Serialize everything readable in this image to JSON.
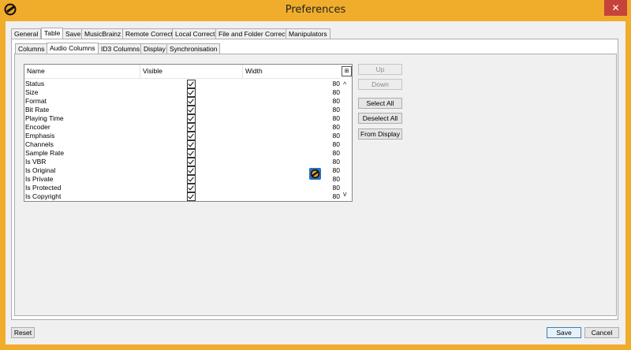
{
  "window": {
    "title": "Preferences",
    "close_label": "✕"
  },
  "top_tabs": [
    "General",
    "Table",
    "Save",
    "MusicBrainz",
    "Remote Correct",
    "Local Correct",
    "File and Folder Correct",
    "Manipulators"
  ],
  "sub_tabs": [
    "Columns",
    "Audio Columns",
    "ID3 Columns",
    "Display",
    "Synchronisation"
  ],
  "table": {
    "headers": [
      "Name",
      "Visible",
      "Width"
    ],
    "rows": [
      {
        "name": "Status",
        "width": "80"
      },
      {
        "name": "Size",
        "width": "80"
      },
      {
        "name": "Format",
        "width": "80"
      },
      {
        "name": "Bit Rate",
        "width": "80"
      },
      {
        "name": "Playing Time",
        "width": "80"
      },
      {
        "name": "Encoder",
        "width": "80"
      },
      {
        "name": "Emphasis",
        "width": "80"
      },
      {
        "name": "Channels",
        "width": "80"
      },
      {
        "name": "Sample Rate",
        "width": "80"
      },
      {
        "name": "Is VBR",
        "width": "80"
      },
      {
        "name": "Is Original",
        "width": "80"
      },
      {
        "name": "Is Private",
        "width": "80"
      },
      {
        "name": "Is Protected",
        "width": "80"
      },
      {
        "name": "Is Copyright",
        "width": "80"
      }
    ],
    "corner_glyph": "⊞",
    "scroll_up": "^",
    "scroll_down": "v"
  },
  "side_buttons": {
    "up": "Up",
    "down": "Down",
    "select_all": "Select All",
    "deselect_all": "Deselect All",
    "from_display": "From Display"
  },
  "footer": {
    "reset": "Reset",
    "save": "Save",
    "cancel": "Cancel"
  }
}
